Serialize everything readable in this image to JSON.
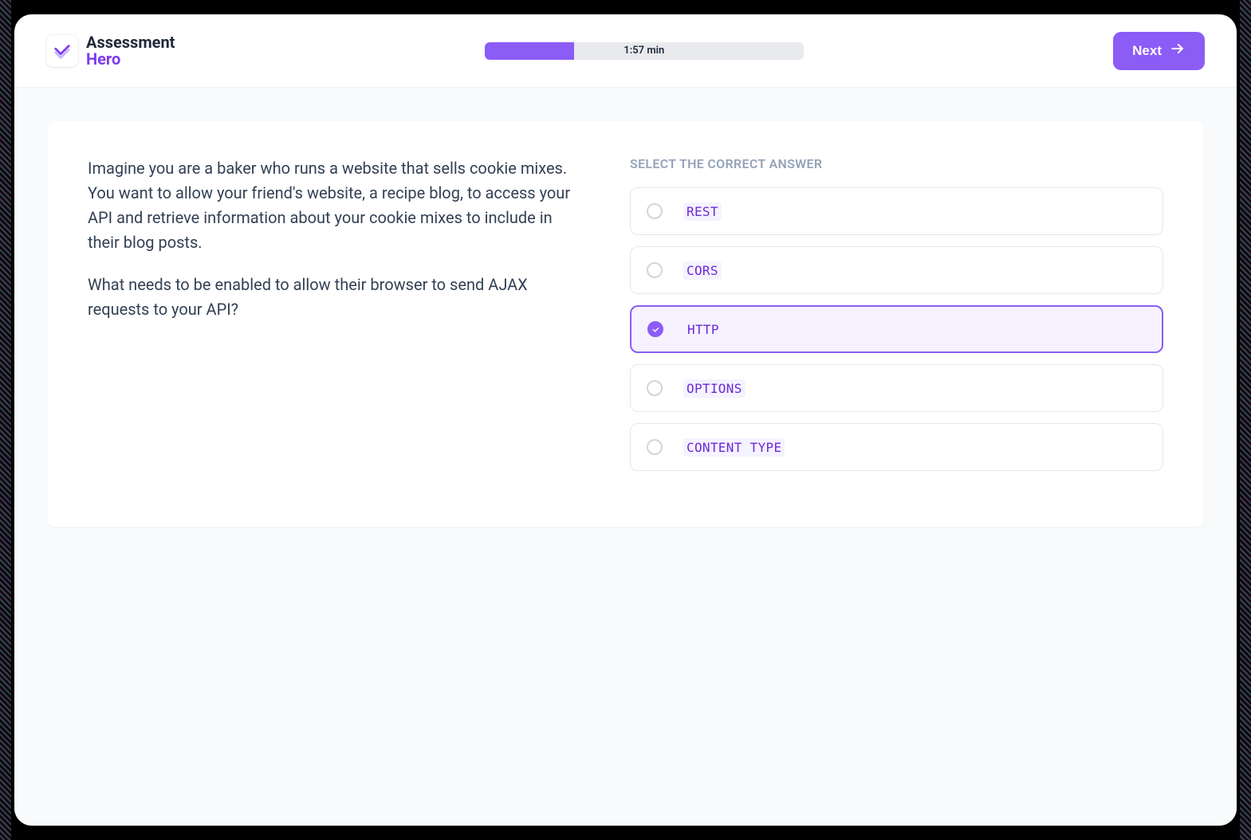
{
  "brand": {
    "line1": "Assessment",
    "line2": "Hero"
  },
  "progress": {
    "label": "1:57 min",
    "percent": 28
  },
  "next_button": {
    "label": "Next"
  },
  "question": {
    "paragraphs": [
      "Imagine you are a baker who runs a website that sells cookie mixes. You want to allow your friend's website, a recipe blog, to access your API and retrieve information about your cookie mixes to include in their blog posts.",
      "What needs to be enabled to allow their browser to send AJAX requests to your API?"
    ]
  },
  "answers": {
    "heading": "SELECT THE CORRECT ANSWER",
    "options": [
      {
        "label": "REST",
        "selected": false
      },
      {
        "label": "CORS",
        "selected": false
      },
      {
        "label": "HTTP",
        "selected": true
      },
      {
        "label": "OPTIONS",
        "selected": false
      },
      {
        "label": "CONTENT TYPE",
        "selected": false
      }
    ]
  },
  "colors": {
    "accent": "#8b5cf6",
    "accent_dark": "#6d28d9",
    "text": "#334155",
    "muted": "#94a3b8"
  }
}
